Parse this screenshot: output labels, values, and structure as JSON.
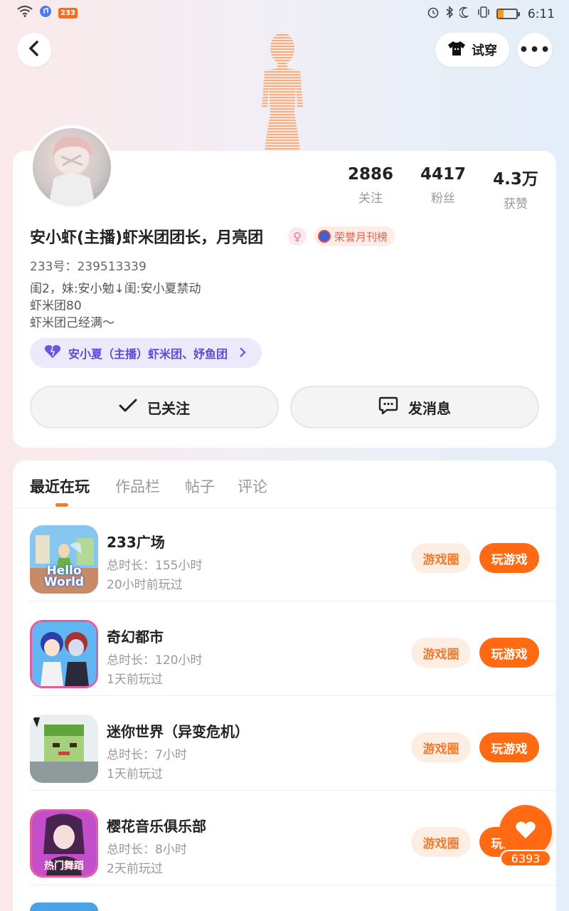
{
  "status_bar": {
    "app_badge": "233",
    "time": "6:11"
  },
  "header": {
    "tryon_label": "试穿",
    "more_label": "•••"
  },
  "profile": {
    "stats": [
      {
        "value": "2886",
        "label": "关注"
      },
      {
        "value": "4417",
        "label": "粉丝"
      },
      {
        "value": "4.3万",
        "label": "获赞"
      }
    ],
    "name": "安小虾(主播)虾米团团长，月亮团",
    "gender_symbol": "♀",
    "honor_badge": "荣誉月刊榜",
    "uid": "233号：239513339",
    "bio_lines": [
      "闺2，妹:安小勉↓闺:安小夏禁动",
      "虾米团80",
      "虾米团己经满～"
    ],
    "group_pill": "安小夏（主播）虾米团、妤鱼团",
    "follow_button": "已关注",
    "message_button": "发消息"
  },
  "tabs": [
    "最近在玩",
    "作品栏",
    "帖子",
    "评论"
  ],
  "games": [
    {
      "title": "233广场",
      "duration": "总时长：155小时",
      "last_played": "20小时前玩过",
      "circle_label": "游戏圈",
      "play_label": "玩游戏",
      "icon_text": "Hello World"
    },
    {
      "title": "奇幻都市",
      "duration": "总时长：120小时",
      "last_played": "1天前玩过",
      "circle_label": "游戏圈",
      "play_label": "玩游戏",
      "icon_text": ""
    },
    {
      "title": "迷你世界（异变危机）",
      "duration": "总时长：7小时",
      "last_played": "1天前玩过",
      "circle_label": "游戏圈",
      "play_label": "玩游戏",
      "icon_text": ""
    },
    {
      "title": "樱花音乐俱乐部",
      "duration": "总时长：8小时",
      "last_played": "2天前玩过",
      "circle_label": "游戏圈",
      "play_label": "玩游戏",
      "icon_text": "热门舞蹈"
    }
  ],
  "like_fab": {
    "count": "6393"
  },
  "colors": {
    "accent": "#ff6a12",
    "purple": "#5b4bd6"
  }
}
